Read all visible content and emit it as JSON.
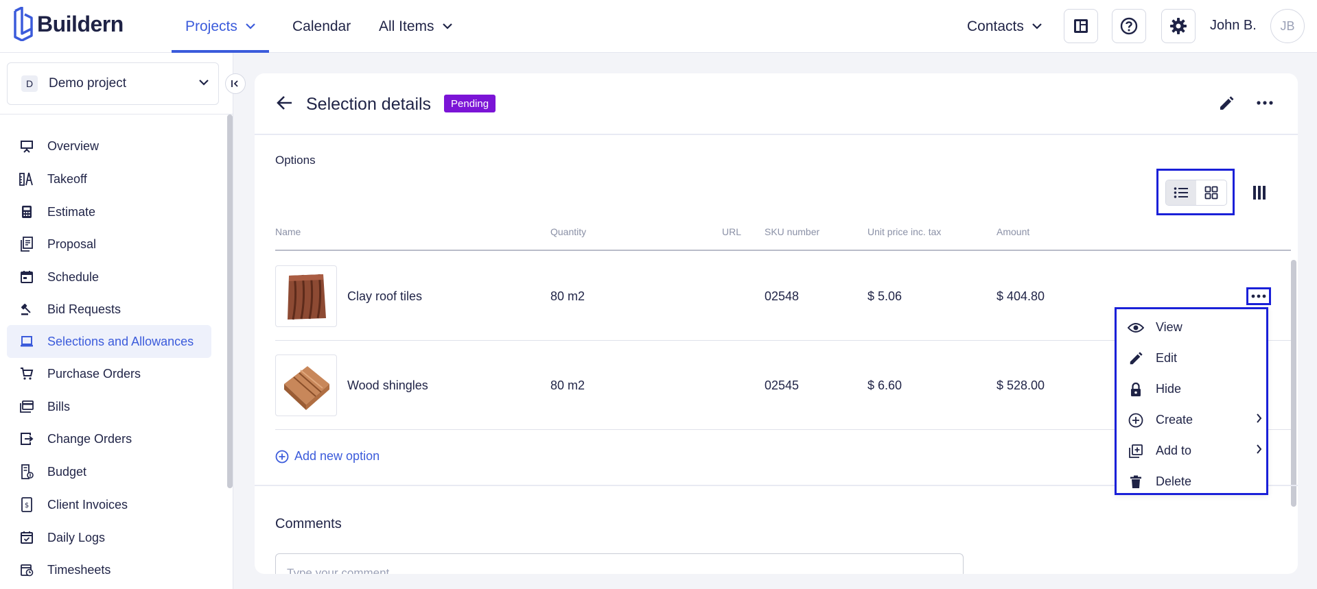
{
  "app": {
    "logo_text": "Buildern",
    "brand_color": "#3b5bdb"
  },
  "topnav": {
    "items": [
      {
        "label": "Projects",
        "has_dropdown": true,
        "active": true
      },
      {
        "label": "Calendar",
        "has_dropdown": false,
        "active": false
      },
      {
        "label": "All Items",
        "has_dropdown": true,
        "active": false
      }
    ],
    "contacts_label": "Contacts",
    "icons": [
      "dashboard-icon",
      "help-icon",
      "settings-icon"
    ],
    "user_name": "John B.",
    "user_initials": "JB"
  },
  "sidebar": {
    "project": {
      "badge": "D",
      "name": "Demo project"
    },
    "items": [
      {
        "label": "Overview",
        "icon": "presentation-icon",
        "active": false
      },
      {
        "label": "Takeoff",
        "icon": "takeoff-icon",
        "active": false
      },
      {
        "label": "Estimate",
        "icon": "calculator-icon",
        "active": false
      },
      {
        "label": "Proposal",
        "icon": "proposal-icon",
        "active": false
      },
      {
        "label": "Schedule",
        "icon": "calendar-icon",
        "active": false
      },
      {
        "label": "Bid Requests",
        "icon": "gavel-icon",
        "active": false
      },
      {
        "label": "Selections and Allowances",
        "icon": "laptop-icon",
        "active": true
      },
      {
        "label": "Purchase Orders",
        "icon": "cart-icon",
        "active": false
      },
      {
        "label": "Bills",
        "icon": "bills-icon",
        "active": false
      },
      {
        "label": "Change Orders",
        "icon": "change-orders-icon",
        "active": false
      },
      {
        "label": "Budget",
        "icon": "budget-icon",
        "active": false
      },
      {
        "label": "Client Invoices",
        "icon": "invoice-icon",
        "active": false
      },
      {
        "label": "Daily Logs",
        "icon": "daily-log-icon",
        "active": false
      },
      {
        "label": "Timesheets",
        "icon": "timesheet-icon",
        "active": false
      }
    ]
  },
  "main": {
    "title": "Selection details",
    "status": "Pending",
    "status_color": "#7b14d6",
    "options_label": "Options",
    "columns": [
      "Name",
      "Quantity",
      "URL",
      "SKU number",
      "Unit price inc. tax",
      "Amount"
    ],
    "rows": [
      {
        "name": "Clay roof tiles",
        "quantity": "80 m2",
        "url": "",
        "sku": "02548",
        "unit_price": "$ 5.06",
        "amount": "$ 404.80"
      },
      {
        "name": "Wood shingles",
        "quantity": "80 m2",
        "url": "",
        "sku": "02545",
        "unit_price": "$ 6.60",
        "amount": "$ 528.00"
      }
    ],
    "add_option_label": "Add new option",
    "comments_title": "Comments",
    "comment_placeholder": "Type your comment"
  },
  "context_menu": {
    "items": [
      {
        "label": "View",
        "icon": "eye-icon",
        "submenu": false
      },
      {
        "label": "Edit",
        "icon": "pencil-icon",
        "submenu": false
      },
      {
        "label": "Hide",
        "icon": "lock-icon",
        "submenu": false
      },
      {
        "label": "Create",
        "icon": "plus-circle-icon",
        "submenu": true
      },
      {
        "label": "Add to",
        "icon": "add-to-icon",
        "submenu": true
      },
      {
        "label": "Delete",
        "icon": "trash-icon",
        "submenu": false
      }
    ]
  }
}
